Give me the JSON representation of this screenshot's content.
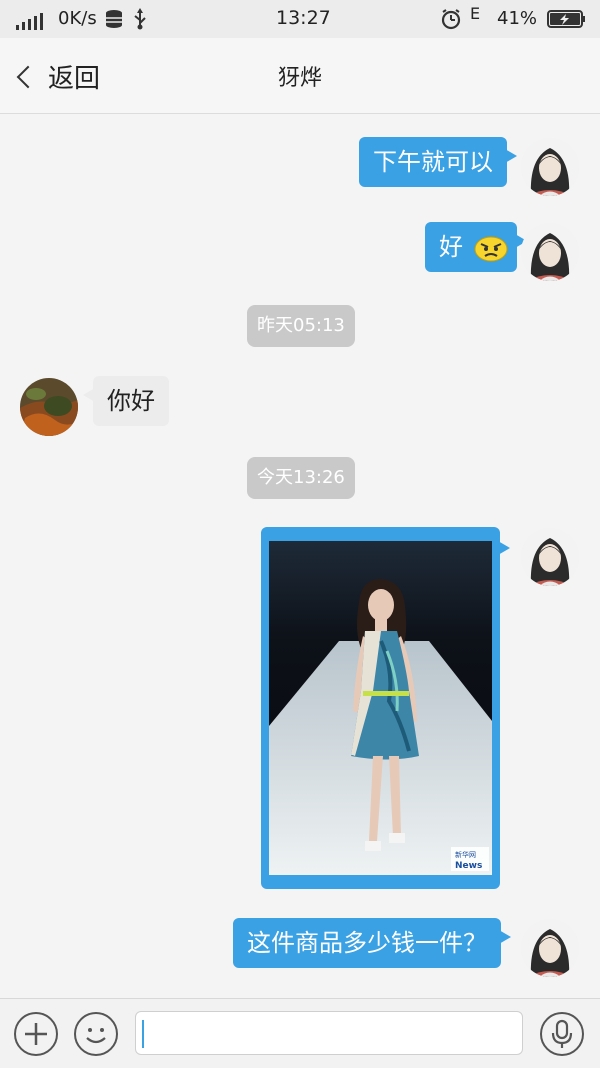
{
  "status": {
    "speed": "0K/s",
    "time": "13:27",
    "net_type": "E",
    "battery": "41%"
  },
  "header": {
    "back_label": "返回",
    "title": "犽烨"
  },
  "messages": {
    "m1": "下午就可以",
    "m2_text": "好",
    "time1": "昨天05:13",
    "m3": "你好",
    "time2": "今天13:26",
    "m5": "这件商品多少钱一件？"
  },
  "image": {
    "watermark_line1": "新华网",
    "watermark_line2": "News"
  },
  "colors": {
    "accent": "#3aa1e4",
    "time_chip": "#c9c9c9"
  }
}
